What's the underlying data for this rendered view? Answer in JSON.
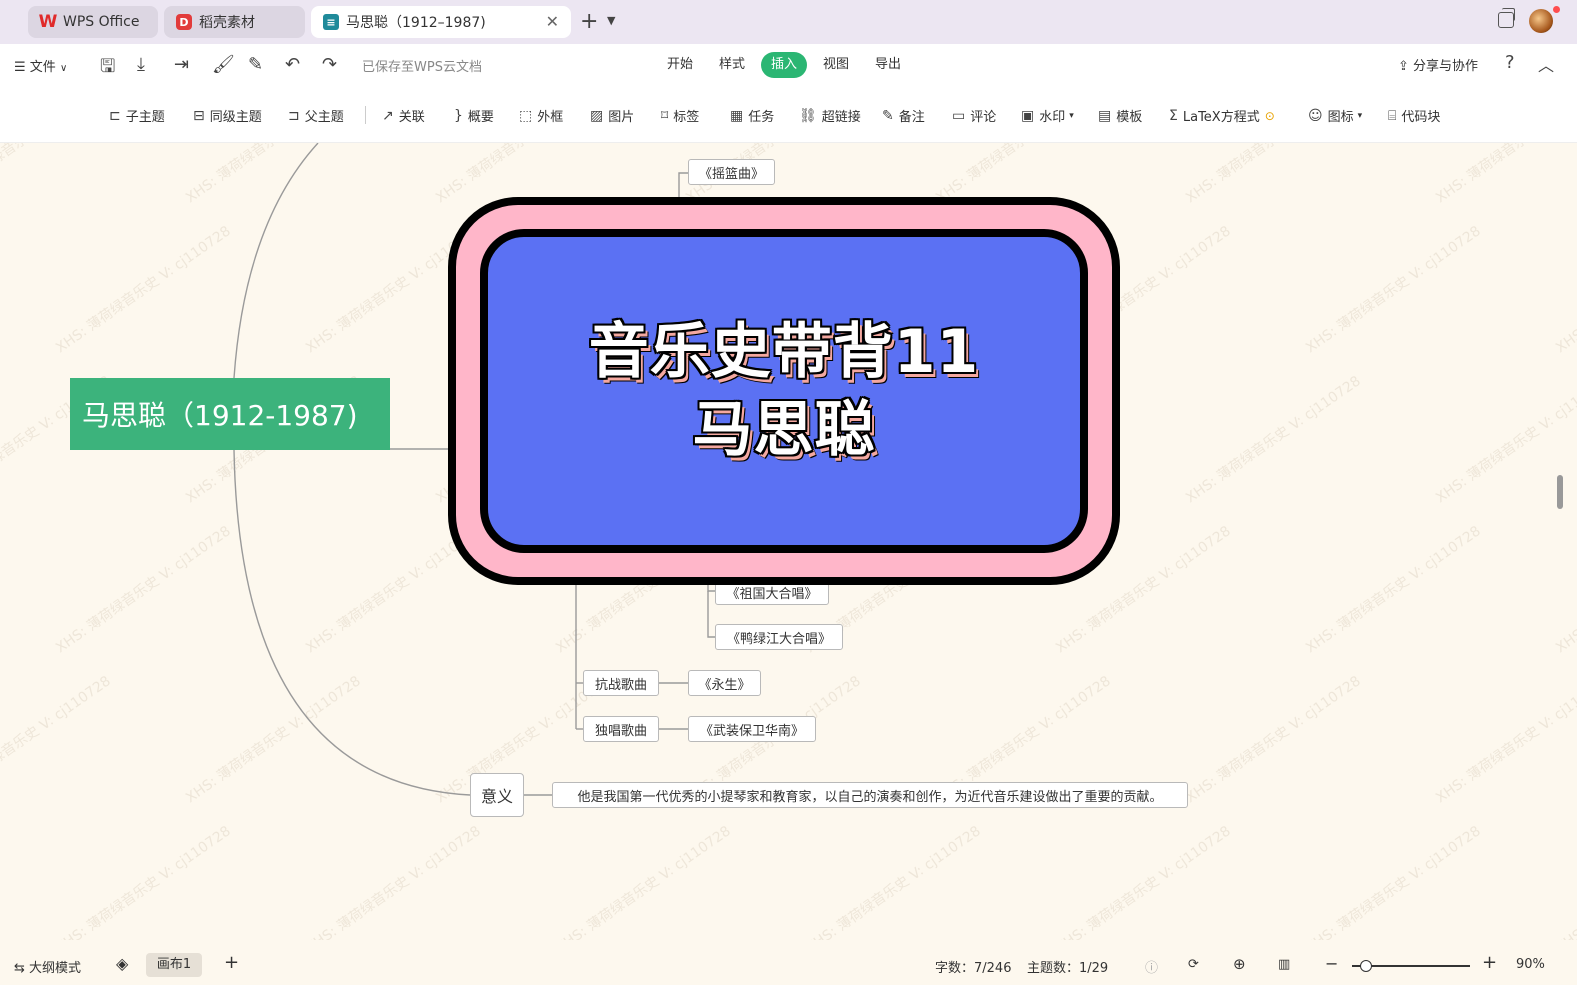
{
  "tabs": {
    "wps_label": "WPS Office",
    "daoke_label": "稻壳素材",
    "doc_label": "马思聪（1912–1987)"
  },
  "menu": {
    "file_label": "文件",
    "saved_status": "已保存至WPS云文档",
    "main_tabs": [
      "开始",
      "样式",
      "插入",
      "视图",
      "导出"
    ],
    "active_tab": "插入",
    "share_label": "分享与协作"
  },
  "toolbar": {
    "items": [
      {
        "label": "子主题",
        "icon": "subtopic-icon"
      },
      {
        "label": "同级主题",
        "icon": "sibling-topic-icon"
      },
      {
        "label": "父主题",
        "icon": "parent-topic-icon"
      },
      {
        "label": "关联",
        "icon": "relation-icon"
      },
      {
        "label": "概要",
        "icon": "summary-icon"
      },
      {
        "label": "外框",
        "icon": "boundary-icon"
      },
      {
        "label": "图片",
        "icon": "image-icon"
      },
      {
        "label": "标签",
        "icon": "tag-icon"
      },
      {
        "label": "任务",
        "icon": "task-icon"
      },
      {
        "label": "超链接",
        "icon": "link-icon"
      },
      {
        "label": "备注",
        "icon": "note-icon"
      },
      {
        "label": "评论",
        "icon": "comment-icon"
      },
      {
        "label": "水印",
        "icon": "watermark-icon"
      },
      {
        "label": "模板",
        "icon": "template-icon"
      },
      {
        "label": "LaTeX方程式",
        "icon": "formula-icon"
      },
      {
        "label": "图标",
        "icon": "emoji-icon"
      },
      {
        "label": "代码块",
        "icon": "code-block-icon"
      }
    ]
  },
  "mindmap": {
    "root": "马思聪（1912-1987)",
    "top_work": "《摇篮曲》",
    "chorus_works": [
      "《祖国大合唱》",
      "《鸭绿江大合唱》"
    ],
    "war_songs_label": "抗战歌曲",
    "war_songs_work": "《永生》",
    "solo_songs_label": "独唱歌曲",
    "solo_songs_work": "《武装保卫华南》",
    "meaning_label": "意义",
    "meaning_text": "他是我国第一代优秀的小提琴家和教育家，以自己的演奏和创作，为近代音乐建设做出了重要的贡献。"
  },
  "cover": {
    "line1": "音乐史带背11",
    "line2": "马思聪",
    "colors": {
      "outer": "#ffb6c9",
      "inner": "#5b71f3"
    }
  },
  "watermark": "XHS: 薄荷绿音乐史 V: cj110728",
  "status": {
    "outline_mode": "大纲模式",
    "canvas_tab": "画布1",
    "word_count": "字数：7/246",
    "topic_count": "主题数：1/29",
    "zoom": "90%",
    "zoom_level": 0.9
  },
  "colors": {
    "accent": "#2bb673",
    "root": "#3cb37c"
  }
}
